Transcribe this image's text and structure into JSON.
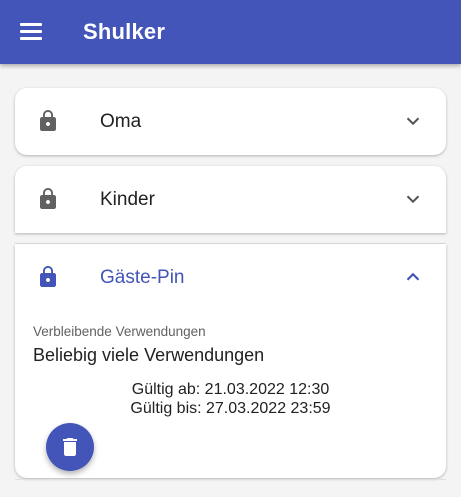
{
  "appbar": {
    "title": "Shulker",
    "menu_icon": "menu-icon",
    "color": "#4355b8"
  },
  "pins": [
    {
      "name": "Oma",
      "icon": "lock-icon",
      "expanded": false
    },
    {
      "name": "Kinder",
      "icon": "lock-icon",
      "expanded": false
    },
    {
      "name": "Gäste-Pin",
      "icon": "lock-icon",
      "expanded": true
    }
  ],
  "expanded_pin": {
    "uses_label": "Verbleibende Verwendungen",
    "uses_value": "Beliebig viele Verwendungen",
    "valid_from": "Gültig ab: 21.03.2022 12:30",
    "valid_until": "Gültig bis: 27.03.2022 23:59",
    "delete_icon": "trash-icon"
  },
  "colors": {
    "accent": "#4355b8",
    "lock_inactive": "#616161",
    "text": "#212121"
  }
}
